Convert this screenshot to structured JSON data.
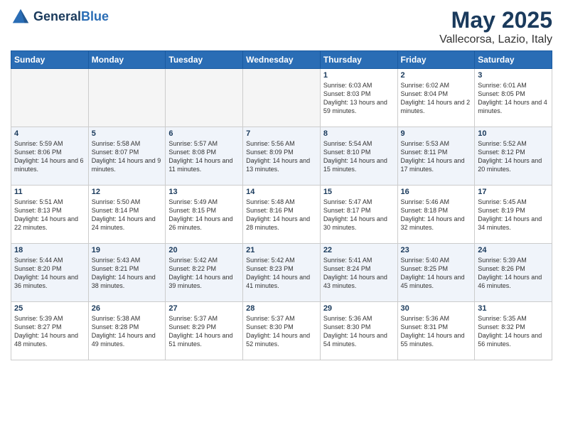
{
  "header": {
    "logo_general": "General",
    "logo_blue": "Blue",
    "month": "May 2025",
    "location": "Vallecorsa, Lazio, Italy"
  },
  "days_of_week": [
    "Sunday",
    "Monday",
    "Tuesday",
    "Wednesday",
    "Thursday",
    "Friday",
    "Saturday"
  ],
  "weeks": [
    [
      {
        "day": "",
        "empty": true
      },
      {
        "day": "",
        "empty": true
      },
      {
        "day": "",
        "empty": true
      },
      {
        "day": "",
        "empty": true
      },
      {
        "day": "1",
        "sunrise": "6:03 AM",
        "sunset": "8:03 PM",
        "daylight": "13 hours and 59 minutes."
      },
      {
        "day": "2",
        "sunrise": "6:02 AM",
        "sunset": "8:04 PM",
        "daylight": "14 hours and 2 minutes."
      },
      {
        "day": "3",
        "sunrise": "6:01 AM",
        "sunset": "8:05 PM",
        "daylight": "14 hours and 4 minutes."
      }
    ],
    [
      {
        "day": "4",
        "sunrise": "5:59 AM",
        "sunset": "8:06 PM",
        "daylight": "14 hours and 6 minutes."
      },
      {
        "day": "5",
        "sunrise": "5:58 AM",
        "sunset": "8:07 PM",
        "daylight": "14 hours and 9 minutes."
      },
      {
        "day": "6",
        "sunrise": "5:57 AM",
        "sunset": "8:08 PM",
        "daylight": "14 hours and 11 minutes."
      },
      {
        "day": "7",
        "sunrise": "5:56 AM",
        "sunset": "8:09 PM",
        "daylight": "14 hours and 13 minutes."
      },
      {
        "day": "8",
        "sunrise": "5:54 AM",
        "sunset": "8:10 PM",
        "daylight": "14 hours and 15 minutes."
      },
      {
        "day": "9",
        "sunrise": "5:53 AM",
        "sunset": "8:11 PM",
        "daylight": "14 hours and 17 minutes."
      },
      {
        "day": "10",
        "sunrise": "5:52 AM",
        "sunset": "8:12 PM",
        "daylight": "14 hours and 20 minutes."
      }
    ],
    [
      {
        "day": "11",
        "sunrise": "5:51 AM",
        "sunset": "8:13 PM",
        "daylight": "14 hours and 22 minutes."
      },
      {
        "day": "12",
        "sunrise": "5:50 AM",
        "sunset": "8:14 PM",
        "daylight": "14 hours and 24 minutes."
      },
      {
        "day": "13",
        "sunrise": "5:49 AM",
        "sunset": "8:15 PM",
        "daylight": "14 hours and 26 minutes."
      },
      {
        "day": "14",
        "sunrise": "5:48 AM",
        "sunset": "8:16 PM",
        "daylight": "14 hours and 28 minutes."
      },
      {
        "day": "15",
        "sunrise": "5:47 AM",
        "sunset": "8:17 PM",
        "daylight": "14 hours and 30 minutes."
      },
      {
        "day": "16",
        "sunrise": "5:46 AM",
        "sunset": "8:18 PM",
        "daylight": "14 hours and 32 minutes."
      },
      {
        "day": "17",
        "sunrise": "5:45 AM",
        "sunset": "8:19 PM",
        "daylight": "14 hours and 34 minutes."
      }
    ],
    [
      {
        "day": "18",
        "sunrise": "5:44 AM",
        "sunset": "8:20 PM",
        "daylight": "14 hours and 36 minutes."
      },
      {
        "day": "19",
        "sunrise": "5:43 AM",
        "sunset": "8:21 PM",
        "daylight": "14 hours and 38 minutes."
      },
      {
        "day": "20",
        "sunrise": "5:42 AM",
        "sunset": "8:22 PM",
        "daylight": "14 hours and 39 minutes."
      },
      {
        "day": "21",
        "sunrise": "5:42 AM",
        "sunset": "8:23 PM",
        "daylight": "14 hours and 41 minutes."
      },
      {
        "day": "22",
        "sunrise": "5:41 AM",
        "sunset": "8:24 PM",
        "daylight": "14 hours and 43 minutes."
      },
      {
        "day": "23",
        "sunrise": "5:40 AM",
        "sunset": "8:25 PM",
        "daylight": "14 hours and 45 minutes."
      },
      {
        "day": "24",
        "sunrise": "5:39 AM",
        "sunset": "8:26 PM",
        "daylight": "14 hours and 46 minutes."
      }
    ],
    [
      {
        "day": "25",
        "sunrise": "5:39 AM",
        "sunset": "8:27 PM",
        "daylight": "14 hours and 48 minutes."
      },
      {
        "day": "26",
        "sunrise": "5:38 AM",
        "sunset": "8:28 PM",
        "daylight": "14 hours and 49 minutes."
      },
      {
        "day": "27",
        "sunrise": "5:37 AM",
        "sunset": "8:29 PM",
        "daylight": "14 hours and 51 minutes."
      },
      {
        "day": "28",
        "sunrise": "5:37 AM",
        "sunset": "8:30 PM",
        "daylight": "14 hours and 52 minutes."
      },
      {
        "day": "29",
        "sunrise": "5:36 AM",
        "sunset": "8:30 PM",
        "daylight": "14 hours and 54 minutes."
      },
      {
        "day": "30",
        "sunrise": "5:36 AM",
        "sunset": "8:31 PM",
        "daylight": "14 hours and 55 minutes."
      },
      {
        "day": "31",
        "sunrise": "5:35 AM",
        "sunset": "8:32 PM",
        "daylight": "14 hours and 56 minutes."
      }
    ]
  ]
}
